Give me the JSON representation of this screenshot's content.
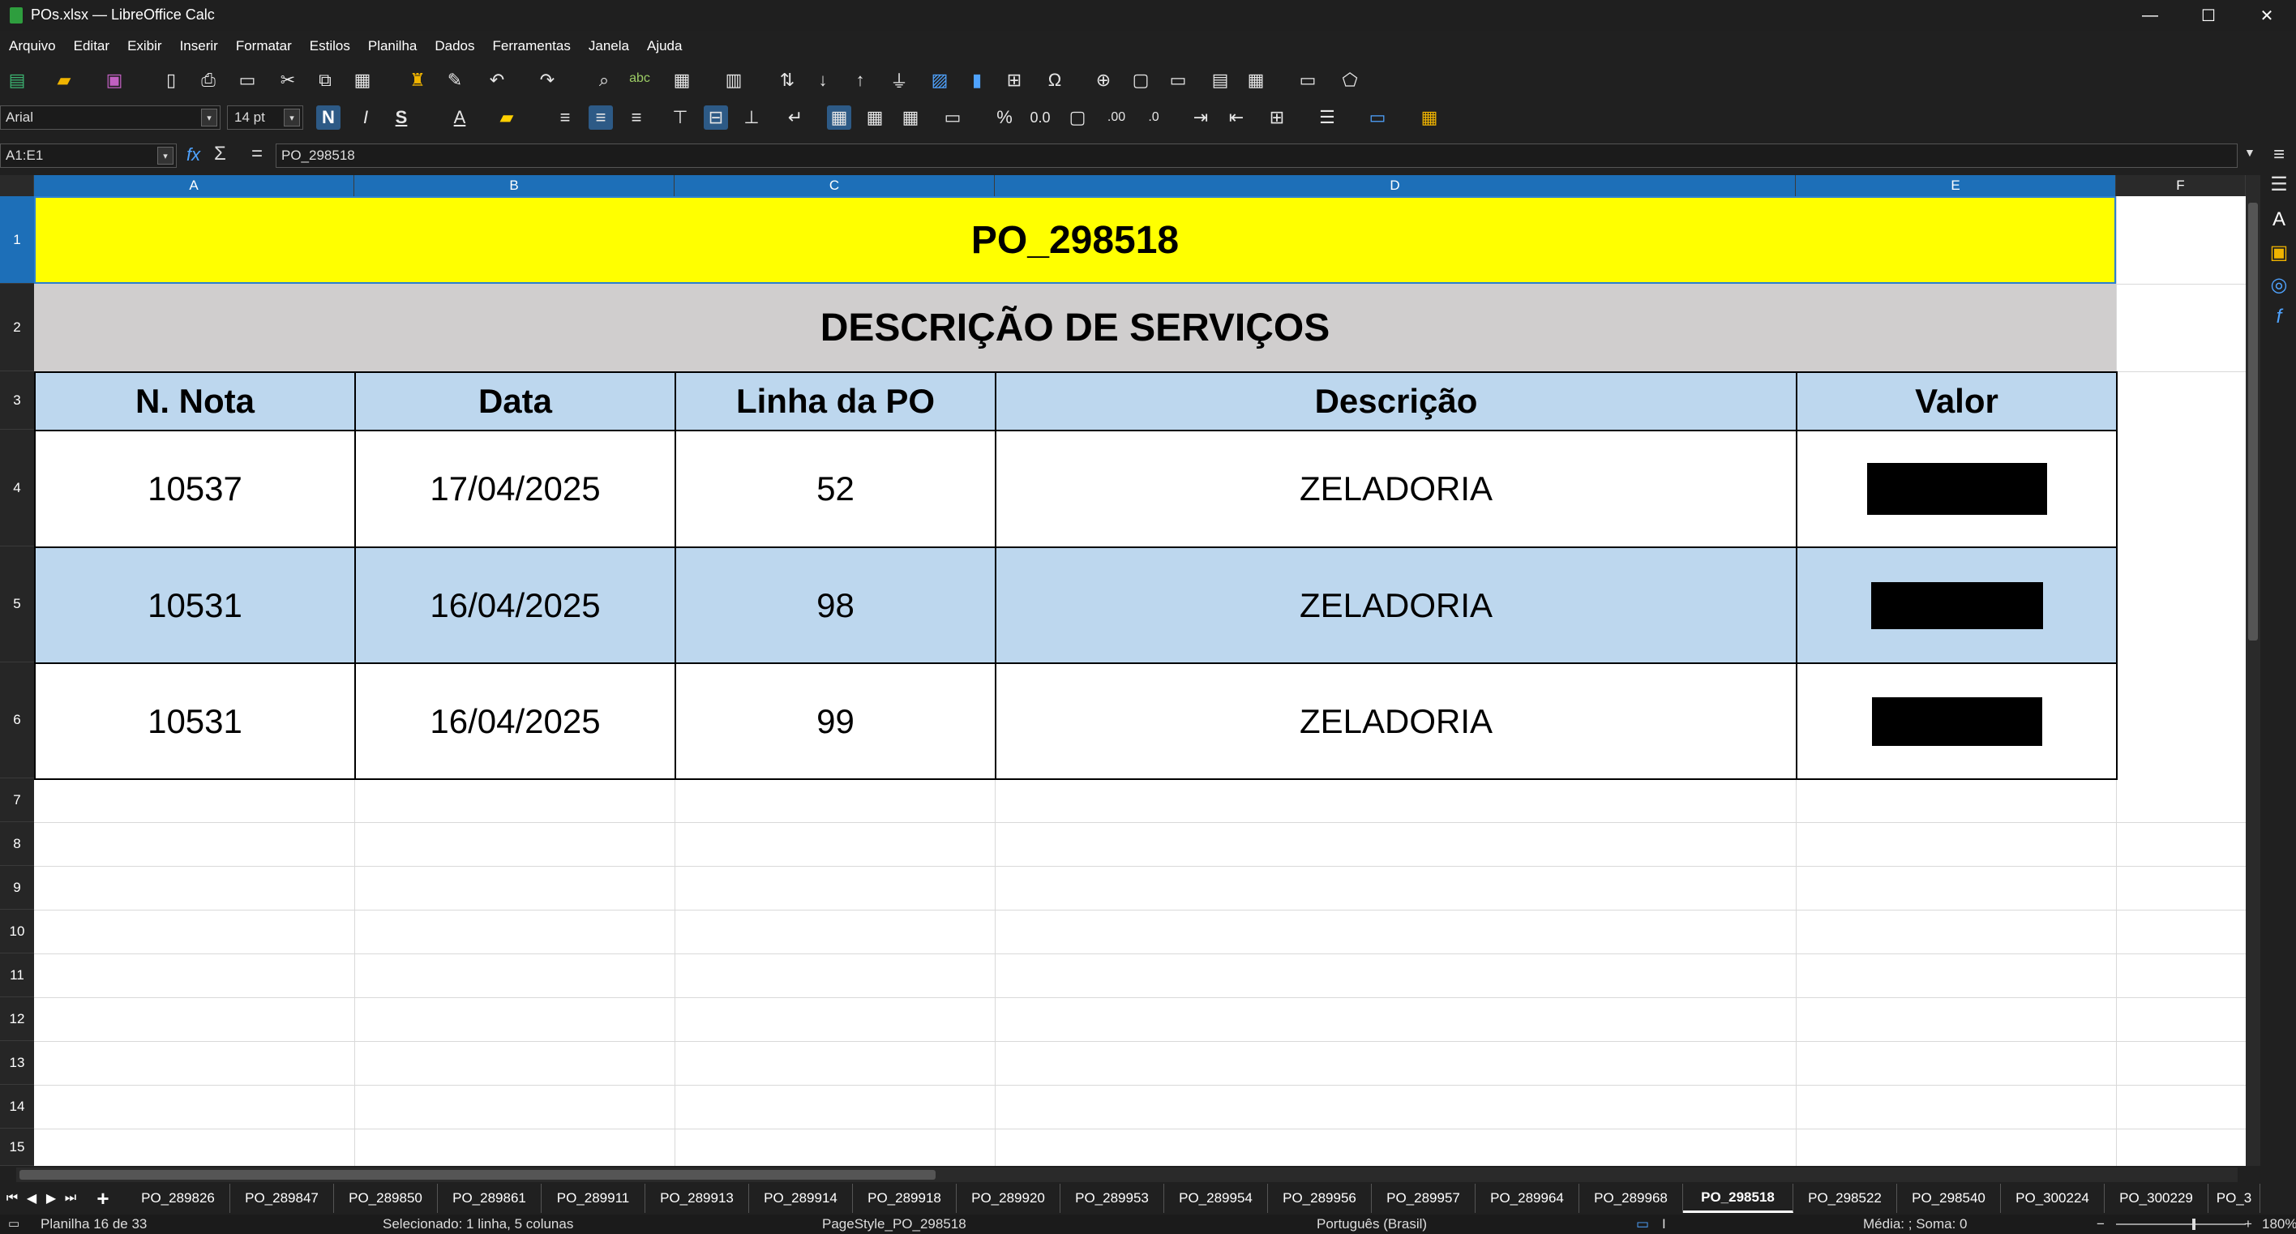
{
  "window": {
    "title": "POs.xlsx — LibreOffice Calc",
    "min": "—",
    "max": "☐",
    "close": "✕"
  },
  "menu": [
    "Arquivo",
    "Editar",
    "Exibir",
    "Inserir",
    "Formatar",
    "Estilos",
    "Planilha",
    "Dados",
    "Ferramentas",
    "Janela",
    "Ajuda"
  ],
  "formatting": {
    "font_name": "Arial",
    "font_size": "14 pt",
    "bold": "N",
    "italic": "I",
    "underline": "S"
  },
  "formula_bar": {
    "name_box": "A1:E1",
    "fx": "fx",
    "sum": "Σ",
    "equals": "=",
    "content": "PO_298518"
  },
  "columns": [
    "A",
    "B",
    "C",
    "D",
    "E",
    "F"
  ],
  "rows": [
    "1",
    "2",
    "3",
    "4",
    "5",
    "6",
    "7",
    "8",
    "9",
    "10",
    "11",
    "12",
    "13",
    "14",
    "15"
  ],
  "sheet": {
    "title": "PO_298518",
    "subtitle": "DESCRIÇÃO DE SERVIÇOS",
    "headers": [
      "N. Nota",
      "Data",
      "Linha da PO",
      "Descrição",
      "Valor"
    ],
    "data_rows": [
      {
        "nota": "10537",
        "data": "17/04/2025",
        "linha": "52",
        "descricao": "ZELADORIA",
        "valor": ""
      },
      {
        "nota": "10531",
        "data": "16/04/2025",
        "linha": "98",
        "descricao": "ZELADORIA",
        "valor": ""
      },
      {
        "nota": "10531",
        "data": "16/04/2025",
        "linha": "99",
        "descricao": "ZELADORIA",
        "valor": ""
      }
    ]
  },
  "colors": {
    "title_bg": "#ffff00",
    "subtitle_bg": "#d0cece",
    "header_bg": "#bdd7ee",
    "band_bg": "#bdd7ee",
    "selection": "#1d6fb8"
  },
  "tabs": [
    "PO_289826",
    "PO_289847",
    "PO_289850",
    "PO_289861",
    "PO_289911",
    "PO_289913",
    "PO_289914",
    "PO_289918",
    "PO_289920",
    "PO_289953",
    "PO_289954",
    "PO_289956",
    "PO_289957",
    "PO_289964",
    "PO_289968",
    "PO_298518",
    "PO_298522",
    "PO_298540",
    "PO_300224",
    "PO_300229",
    "PO_3"
  ],
  "active_tab": "PO_298518",
  "status": {
    "sheet": "Planilha 16 de 33",
    "selection": "Selecionado: 1 linha, 5 colunas",
    "pagestyle": "PageStyle_PO_298518",
    "language": "Português (Brasil)",
    "stats": "Média: ; Soma: 0",
    "zoom": "180%"
  }
}
